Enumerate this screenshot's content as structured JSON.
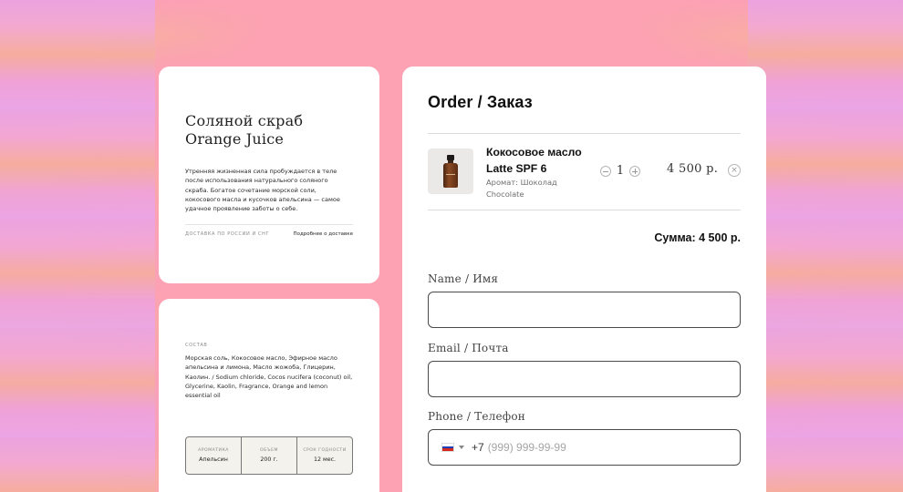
{
  "product": {
    "title": "Соляной скраб\nOrange Juice",
    "description": "Утренняя жизненная сила пробуждается в теле после использования натурального соляного скраба. Богатое сочетание морской соли, кокосового масла и кусочков апельсина — самое удачное проявление заботы о себе.",
    "delivery_label": "ДОСТАВКА ПО РОССИИ И СНГ",
    "delivery_link": "Подробнее о доставке"
  },
  "composition": {
    "label": "СОСТАВ",
    "text": "Морская соль, Кокосовое масло, Эфирное масло апельсина и лимона, Масло жожоба, Глицерин, Каолин. / Sodium chloride, Cocos nucifera (coconut) oil, Glycerine, Kaolin, Fragrance,  Orange and lemon essential oil",
    "specs": [
      {
        "key": "АРОМАТИКА",
        "value": "Апельсин"
      },
      {
        "key": "ОБЪЕМ",
        "value": "200 г."
      },
      {
        "key": "СРОК ГОДНОСТИ",
        "value": "12 мес."
      }
    ]
  },
  "order": {
    "title": "Order / Заказ",
    "item": {
      "name": "Кокосовое масло Latte SPF 6",
      "meta": "Аромат: Шоколад Chocolate",
      "quantity": "1",
      "price": "4 500 р.",
      "remove_icon": "×"
    },
    "total": "Сумма: 4 500 р.",
    "fields": {
      "name_label": "Name / Имя",
      "name_value": "",
      "email_label": "Email / Почта",
      "email_value": "",
      "phone_label": "Phone / Телефон",
      "phone_prefix": "+7",
      "phone_placeholder": "(999) 999-99-99"
    }
  },
  "icons": {
    "minus": "minus-circle-icon",
    "plus": "plus-circle-icon",
    "remove": "close-circle-icon",
    "flag": "russia-flag-icon",
    "caret": "chevron-down-icon"
  },
  "colors": {
    "background_pink": "#fca2b2",
    "background_orange": "#f7b39b",
    "background_violet": "#e9a6ec",
    "card": "#ffffff",
    "specs_bg": "#f4f2ec"
  }
}
